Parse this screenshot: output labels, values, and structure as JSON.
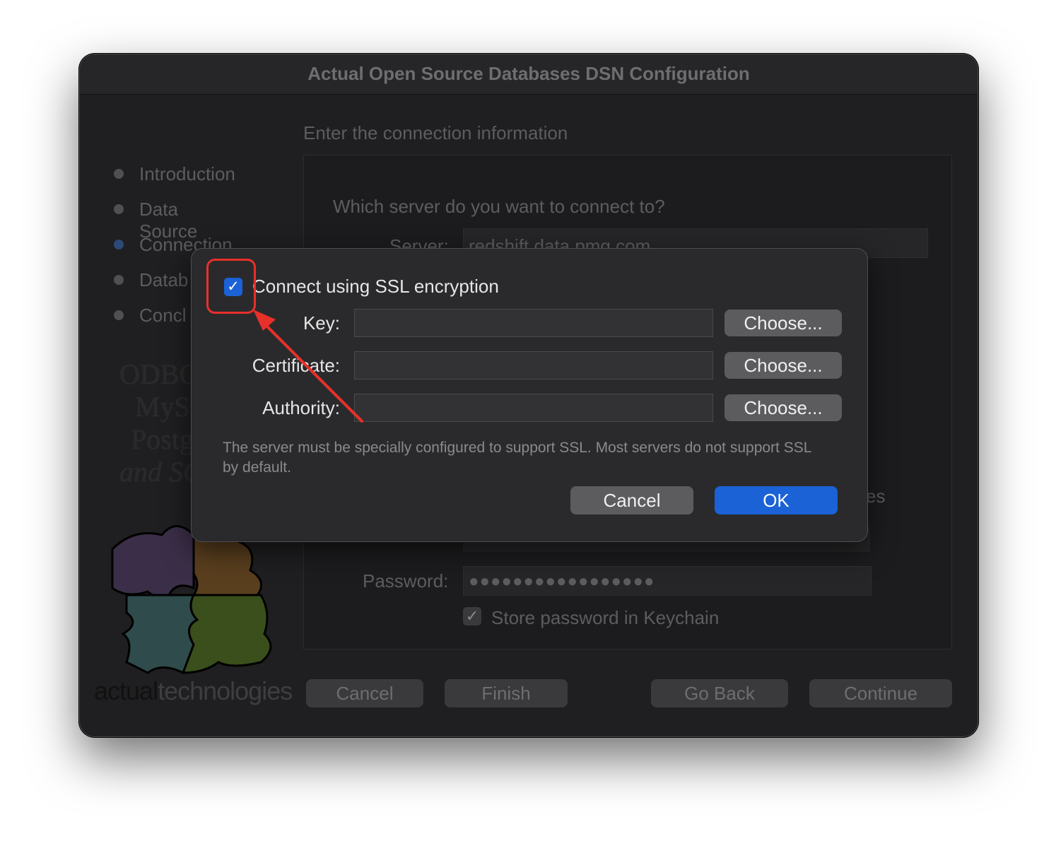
{
  "window": {
    "title": "Actual Open Source Databases DSN Configuration"
  },
  "main": {
    "heading": "Enter the connection information",
    "question": "Which server do you want to connect to?",
    "server_label": "Server:",
    "server_value": "redshift.data.pmg.com",
    "password_label": "Password:",
    "password_mask": "●●●●●●●●●●●●●●●●●",
    "store_password_label": "Store password in Keychain",
    "store_password_checked": true,
    "partial_text": "es"
  },
  "sidebar": {
    "steps": [
      {
        "label": "Introduction",
        "active": false
      },
      {
        "label": "Data Source",
        "active": false
      },
      {
        "label": "Connection",
        "active": true
      },
      {
        "label": "Datab",
        "active": false
      },
      {
        "label": "Concl",
        "active": false
      }
    ],
    "logo_lines": [
      "ODBC",
      "MyS",
      "Postg",
      "and SQ"
    ],
    "brand_a": "actual",
    "brand_b": "technologies"
  },
  "footer": {
    "cancel": "Cancel",
    "finish": "Finish",
    "go_back": "Go Back",
    "continue": "Continue"
  },
  "ssl_dialog": {
    "checkbox_label": "Connect using SSL encryption",
    "checked": true,
    "key_label": "Key:",
    "certificate_label": "Certificate:",
    "authority_label": "Authority:",
    "choose_label": "Choose...",
    "note": "The server must be specially configured to support SSL. Most servers do not support SSL by default.",
    "cancel": "Cancel",
    "ok": "OK"
  },
  "colors": {
    "accent": "#1a62d6",
    "annotation": "#e8302a",
    "window_bg": "#1f1f21"
  }
}
